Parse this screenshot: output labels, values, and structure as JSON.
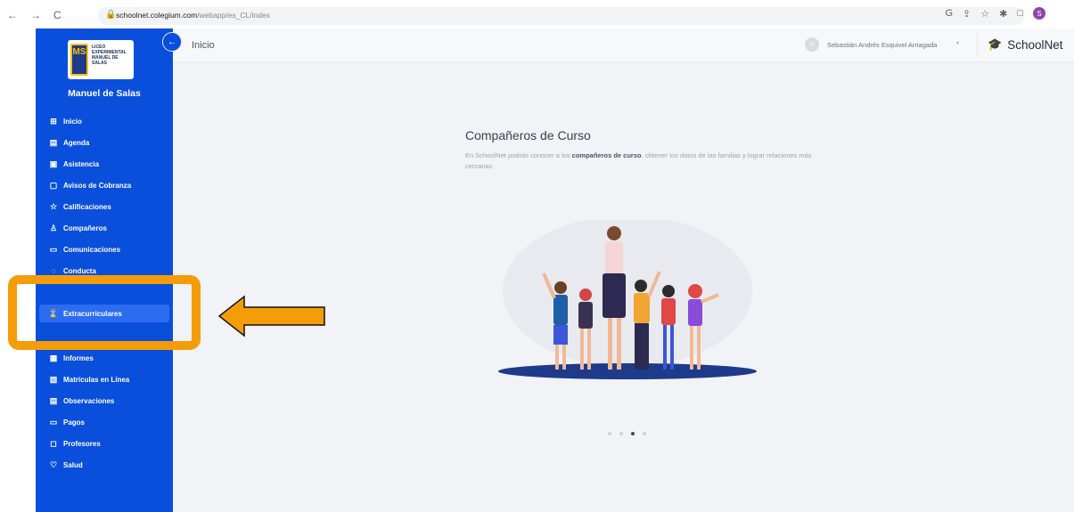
{
  "browser": {
    "url_host": "schoolnet.colegium.com",
    "url_path": "/webapp/es_CL/index",
    "back_icon": "back-arrow-icon",
    "forward_icon": "forward-arrow-icon",
    "reload_icon": "reload-icon",
    "profile_initial": "S"
  },
  "sidebar": {
    "logo_text": "LICEO EXPERIMENTAL MANUEL DE SALAS",
    "logo_mark": "MS",
    "school_name": "Manuel de Salas",
    "items": [
      {
        "label": "Inicio",
        "icon": "grid-icon"
      },
      {
        "label": "Agenda",
        "icon": "agenda-icon"
      },
      {
        "label": "Asistencia",
        "icon": "attendance-icon"
      },
      {
        "label": "Avisos de Cobranza",
        "icon": "billing-notice-icon"
      },
      {
        "label": "Calificaciones",
        "icon": "star-icon"
      },
      {
        "label": "Compañeros",
        "icon": "people-icon"
      },
      {
        "label": "Comunicaciones",
        "icon": "message-icon"
      },
      {
        "label": "Conducta",
        "icon": "conduct-icon"
      },
      {
        "label": "Extracurriculares",
        "icon": "hourglass-icon"
      },
      {
        "label": "Informes",
        "icon": "report-icon"
      },
      {
        "label": "Matrículas en Línea",
        "icon": "enrollment-icon"
      },
      {
        "label": "Observaciones",
        "icon": "observation-icon"
      },
      {
        "label": "Pagos",
        "icon": "card-icon"
      },
      {
        "label": "Profesores",
        "icon": "chat-icon"
      },
      {
        "label": "Salud",
        "icon": "heart-icon"
      }
    ],
    "active_item": "Extracurriculares"
  },
  "header": {
    "title": "Inicio",
    "user_initials": "SE",
    "user_name": "Sebastián Andrés Esquivel Arriagada",
    "brand": "SchoolNet"
  },
  "slide": {
    "title": "Compañeros de Curso",
    "desc_part1": "En SchoolNet podrás conocer a los ",
    "desc_bold": "compañeros de curso",
    "desc_part2": ", obtener los datos de las familias y lograr relaciones más cercanas",
    "dots_total": 4,
    "dots_active": 3
  },
  "colors": {
    "sidebar": "#0a4fdc",
    "active_item": "#2c6cf0",
    "highlight": "#f59c0a",
    "main_bg": "#f2f3f6"
  }
}
